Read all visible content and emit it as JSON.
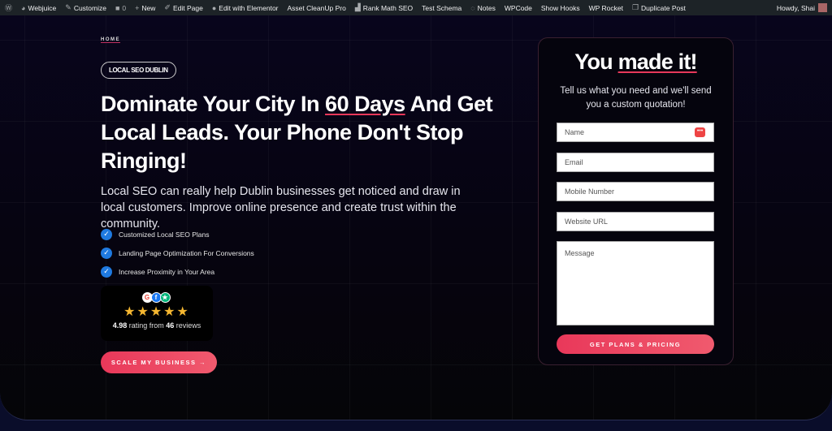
{
  "adminbar": {
    "items": [
      {
        "icon": "wordpress-icon",
        "label": ""
      },
      {
        "icon": "dashboard-icon",
        "label": "Webjuice"
      },
      {
        "icon": "brush-icon",
        "label": "Customize"
      },
      {
        "icon": "comment-icon",
        "label": "0"
      },
      {
        "icon": "plus-icon",
        "label": "New"
      },
      {
        "icon": "pencil-icon",
        "label": "Edit Page"
      },
      {
        "icon": "elementor-icon",
        "label": "Edit with Elementor"
      },
      {
        "icon": "",
        "label": "Asset CleanUp Pro"
      },
      {
        "icon": "rankmath-icon",
        "label": "Rank Math SEO"
      },
      {
        "icon": "",
        "label": "Test Schema"
      },
      {
        "icon": "notes-icon",
        "label": "Notes"
      },
      {
        "icon": "",
        "label": "WPCode"
      },
      {
        "icon": "",
        "label": "Show Hooks"
      },
      {
        "icon": "",
        "label": "WP Rocket"
      },
      {
        "icon": "duplicate-icon",
        "label": "Duplicate Post"
      }
    ],
    "greeting": "Howdy, Shai"
  },
  "hero": {
    "breadcrumb": "HOME",
    "pill": "LOCAL SEO DUBLIN",
    "title_pre": "Dominate Your City In ",
    "title_highlight": "60 Days",
    "title_post": " And Get Local Leads. Your Phone Don't Stop Ringing!",
    "lead": "Local SEO can really help Dublin businesses get noticed and draw in local customers. Improve online presence and create trust within the community.",
    "checks": [
      "Customized Local SEO Plans",
      "Landing Page Optimization For Conversions",
      "Increase Proximity in Your Area"
    ],
    "rating": {
      "score": "4.98",
      "mid": " rating from ",
      "count": "46",
      "suffix": " reviews",
      "stars": 5
    },
    "cta": "SCALE MY BUSINESS →"
  },
  "form": {
    "title_pre": "You ",
    "title_highlight": "made it!",
    "subtitle": "Tell us what you need and we'll send you a custom quotation!",
    "fields": [
      "Name",
      "Email",
      "Mobile Number",
      "Website URL",
      "Message"
    ],
    "submit": "GET PLANS & PRICING"
  },
  "colors": {
    "accent": "#e9385a",
    "check": "#1f7ae0",
    "star": "#f5b731"
  }
}
